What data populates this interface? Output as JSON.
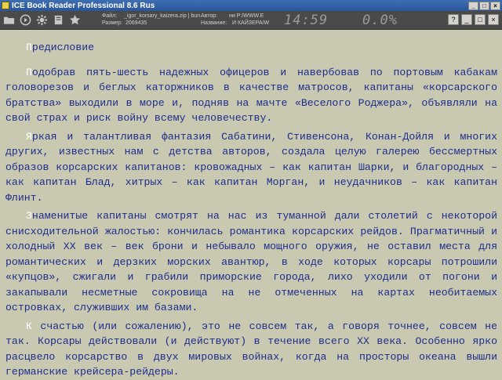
{
  "window": {
    "title": "ICE Book Reader Professional 8.6 Rus",
    "minimize": "_",
    "maximize": "□",
    "close": "×"
  },
  "toolbar": {
    "icons": [
      "folder-icon",
      "play-icon",
      "settings-icon",
      "book-icon",
      "star-icon"
    ],
    "file_label": "Файл:",
    "file_value": "_igor_korsary_kaizera.zip | bun",
    "size_label": "Размер:",
    "size_value": "2069435",
    "author_label": "Автор:",
    "author_value": "ни P:/WWW.E",
    "name_label": "Название:",
    "name_value": "И КАЙЗЕРА/W",
    "clock": "14:59",
    "progress": "0.0%",
    "right_buttons": [
      "?",
      "_",
      "□",
      "×"
    ]
  },
  "book": {
    "heading": {
      "initial": "П",
      "rest": "редисловие"
    },
    "paragraphs": [
      {
        "initial": "П",
        "rest": "одобрав пять-шесть надежных офицеров и навербовав по портовым кабакам головорезов и беглых каторжников в качестве матросов, капитаны «корсарского братства» выходили в море и, подняв на мачте «Веселого Роджера», объявляли на свой страх и риск войну всему человечеству."
      },
      {
        "initial": "Я",
        "rest": "ркая и талантливая фантазия Сабатини, Стивенсона, Конан-Дойля и многих других, известных нам с детства авторов, создала целую галерею бессмертных образов корсарских капитанов: кровожадных – как капитан Шарки, и благородных – как капитан Блад, хитрых – как капитан Морган, и неудачников – как капитан Флинт."
      },
      {
        "initial": "З",
        "rest": "наменитые капитаны смотрят на нас из туманной дали столетий с некоторой снисходительной жалостью: кончилась романтика корсарских рейдов. Прагматичный и холодный XX век – век брони и небывало мощного оружия, не оставил места для романтических и дерзких морских авантюр, в ходе которых корсары потрошили «купцов», сжигали и грабили приморские города, лихо уходили от погони и закапывали несметные сокровища на не отмеченных на картах необитаемых островках, служивших им базами."
      },
      {
        "initial": "К",
        "rest": " счастью (или сожалению), это не совсем так, а говоря точнее, совсем не так. Корсары действовали (и действуют) в течение всего XX века. Особенно ярко расцвело корсарство в двух мировых войнах, когда на просторы океана вышли германские крейсера-рейдеры."
      }
    ]
  }
}
